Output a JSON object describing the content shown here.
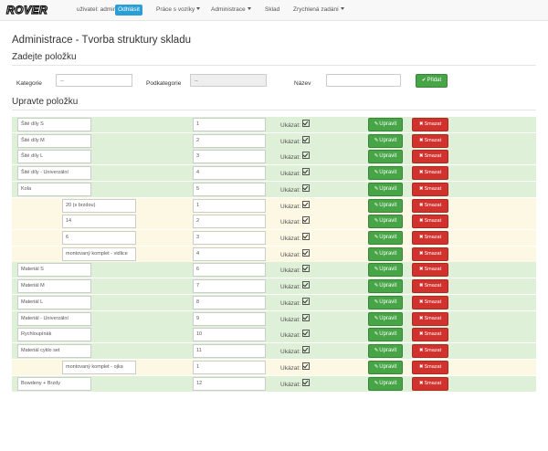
{
  "nav": {
    "logo": "ROVER",
    "user_label": "uživatel: admin",
    "logout": "Odhlásit",
    "menu": [
      "Práce s vozíky",
      "Administrace",
      "Sklad",
      "Zrychlená zadání"
    ]
  },
  "page_title": "Administrace - Tvorba struktury skladu",
  "add_section": {
    "title": "Zadejte položku",
    "category_label": "Kategorie",
    "category_value": "--",
    "subcategory_label": "Podkategorie",
    "subcategory_value": "--",
    "name_label": "Název",
    "name_value": "",
    "add_button": "Přidat"
  },
  "edit_section": {
    "title": "Upravte položku",
    "show_label": "Ukázat:",
    "edit_button": "Upravit",
    "delete_button": "Smazat",
    "rows": [
      {
        "name": "Šité díly S",
        "order": "1",
        "type": "main"
      },
      {
        "name": "Šité díly M",
        "order": "2",
        "type": "main"
      },
      {
        "name": "Šité díly L",
        "order": "3",
        "type": "main"
      },
      {
        "name": "Šité díly - Univerzální",
        "order": "4",
        "type": "main"
      },
      {
        "name": "Kola",
        "order": "5",
        "type": "main"
      },
      {
        "name": "20 (s brzdou)",
        "order": "1",
        "type": "sub"
      },
      {
        "name": "14",
        "order": "2",
        "type": "sub"
      },
      {
        "name": "6",
        "order": "3",
        "type": "sub"
      },
      {
        "name": "montovaný komplet - vidlice",
        "order": "4",
        "type": "sub"
      },
      {
        "name": "Materiál S",
        "order": "6",
        "type": "main"
      },
      {
        "name": "Materiál M",
        "order": "7",
        "type": "main"
      },
      {
        "name": "Materiál L",
        "order": "8",
        "type": "main"
      },
      {
        "name": "Materiál - Univerzální",
        "order": "9",
        "type": "main"
      },
      {
        "name": "Rychloupínák",
        "order": "10",
        "type": "main"
      },
      {
        "name": "Materiál cyklo set",
        "order": "11",
        "type": "main"
      },
      {
        "name": "montovaný komplet - ojka",
        "order": "1",
        "type": "sub"
      },
      {
        "name": "Bowdeny + Brzdy",
        "order": "12",
        "type": "main"
      }
    ]
  }
}
